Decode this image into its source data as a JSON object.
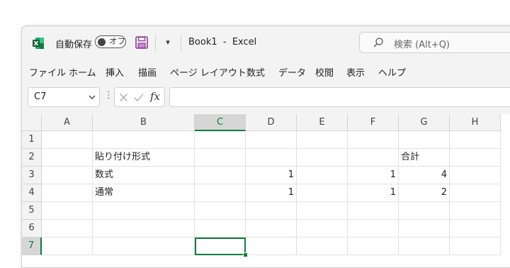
{
  "titlebar": {
    "autosave_label": "自動保存",
    "autosave_toggle": "オフ",
    "document_title": "Book1  -  Excel",
    "search_placeholder": "検索 (Alt+Q)"
  },
  "menu": {
    "items": [
      "ファイル",
      "ホーム",
      "挿入",
      "描画",
      "ページ レイアウト",
      "数式",
      "データ",
      "校閲",
      "表示",
      "ヘルプ"
    ]
  },
  "formula_bar": {
    "name_box": "C7",
    "fx_label": "fx",
    "formula_value": ""
  },
  "sheet": {
    "columns": [
      "A",
      "B",
      "C",
      "D",
      "E",
      "F",
      "G",
      "H"
    ],
    "rows": [
      "1",
      "2",
      "3",
      "4",
      "5",
      "6",
      "7"
    ],
    "selected_column": "C",
    "selected_row": "7",
    "cells": {
      "B2": "貼り付け形式",
      "G2": "合計",
      "B3": "数式",
      "D3": "1",
      "F3": "1",
      "G3": "4",
      "B4": "通常",
      "D4": "1",
      "F4": "1",
      "G4": "2"
    }
  },
  "colors": {
    "excel_green": "#107c41",
    "save_purple": "#8f3f97"
  }
}
